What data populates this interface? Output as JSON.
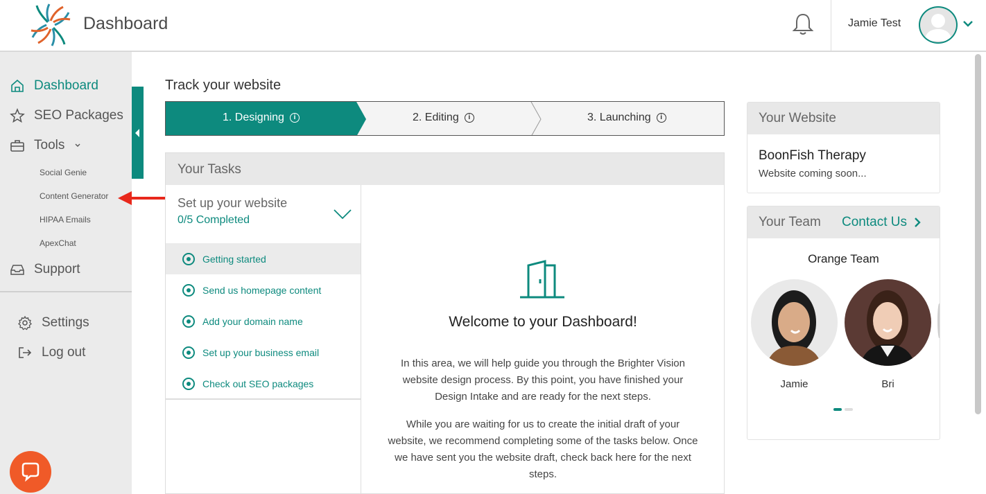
{
  "header": {
    "title": "Dashboard",
    "user_name": "Jamie Test"
  },
  "sidebar": {
    "items": [
      {
        "label": "Dashboard",
        "icon": "home-icon",
        "active": true
      },
      {
        "label": "SEO Packages",
        "icon": "star-icon"
      },
      {
        "label": "Tools",
        "icon": "toolbox-icon",
        "expanded": true
      }
    ],
    "tools_sub": [
      "Social Genie",
      "Content Generator",
      "HIPAA Emails",
      "ApexChat"
    ],
    "support_label": "Support",
    "settings_label": "Settings",
    "logout_label": "Log out"
  },
  "main": {
    "track_title": "Track your website",
    "steps": [
      {
        "label": "1. Designing",
        "active": true
      },
      {
        "label": "2. Editing"
      },
      {
        "label": "3. Launching"
      }
    ],
    "tasks": {
      "title": "Your Tasks",
      "section_title": "Set up your website",
      "progress": "0/5 Completed",
      "items": [
        "Getting started",
        "Send us homepage content",
        "Add your domain name",
        "Set up your business email",
        "Check out SEO packages"
      ]
    },
    "welcome": {
      "title": "Welcome to your Dashboard!",
      "p1": "In this area, we will help guide you through the Brighter Vision website design process. By this point, you have finished your Design Intake and are ready for the next steps.",
      "p2": "While you are waiting for us to create the initial draft of your website, we recommend completing some of the tasks below. Once we have sent you the website draft, check back here for the next steps."
    }
  },
  "website_card": {
    "title": "Your Website",
    "name": "BoonFish Therapy",
    "status": "Website coming soon..."
  },
  "team_card": {
    "title": "Your Team",
    "contact_label": "Contact Us",
    "team_name": "Orange Team",
    "members": [
      "Jamie",
      "Bri"
    ]
  },
  "colors": {
    "accent": "#0d8a7e",
    "chat": "#f05a28",
    "annotation_arrow": "#e8281b"
  }
}
